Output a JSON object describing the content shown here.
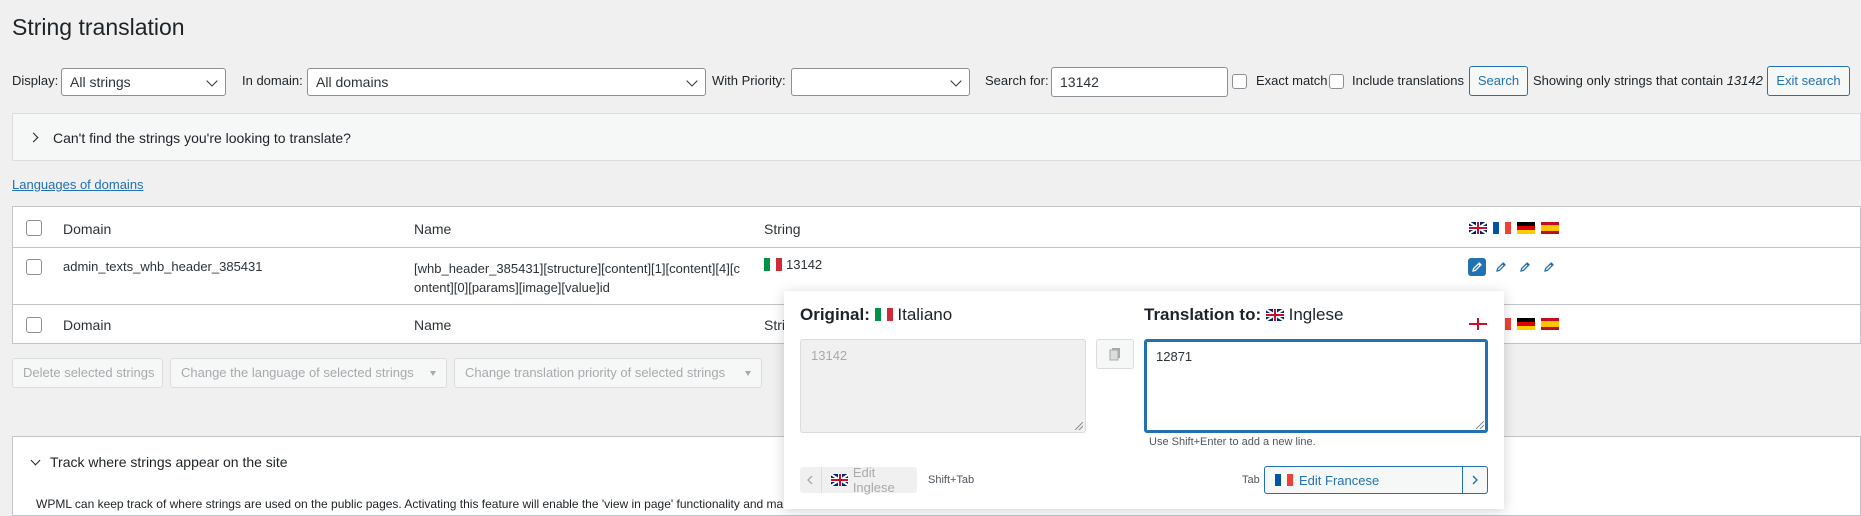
{
  "page": {
    "title": "String translation"
  },
  "filters": {
    "display_label": "Display:",
    "display_value": "All strings",
    "domain_label": "In domain:",
    "domain_value": "All domains",
    "priority_label": "With Priority:",
    "priority_value": "",
    "search_label": "Search for:",
    "search_value": "13142",
    "exact_match_label": "Exact match",
    "include_translations_label": "Include translations",
    "search_button": "Search",
    "showing_text": "Showing only strings that contain",
    "showing_term": "13142",
    "exit_search_button": "Exit search"
  },
  "help_box": {
    "text": "Can't find the strings you're looking to translate?"
  },
  "languages_link": "Languages of domains",
  "table": {
    "columns": {
      "domain": "Domain",
      "name": "Name",
      "string": "String"
    },
    "language_flags": [
      "gb-flag-icon",
      "fr-flag-icon",
      "de-flag-icon",
      "es-flag-icon"
    ],
    "rows": [
      {
        "domain": "admin_texts_whb_header_385431",
        "name_line1": "[whb_header_385431][structure][content][1][content][4][c",
        "name_line2": "ontent][0][params][image][value]id",
        "string": "13142"
      }
    ],
    "footer": {
      "domain": "Domain",
      "name": "Name",
      "string": "Stri"
    }
  },
  "bulk_actions": {
    "delete": "Delete selected strings",
    "change_language": "Change the language of selected strings",
    "change_priority": "Change translation priority of selected strings"
  },
  "track_box": {
    "title": "Track where strings appear on the site",
    "text": "WPML can keep track of where strings are used on the public pages. Activating this feature will enable the 'view in page' functionality and mal"
  },
  "popup": {
    "original_label": "Original:",
    "original_language": "Italiano",
    "original_text": "13142",
    "translation_label": "Translation to:",
    "translation_language": "Inglese",
    "translation_text": "12871",
    "hint": "Use Shift+Enter to add a new line.",
    "prev_button": "Edit Inglese",
    "prev_shortcut": "Shift+Tab",
    "next_shortcut": "Tab",
    "next_button": "Edit Francese"
  },
  "colors": {
    "accent": "#2271b1",
    "background": "#f0f0f1"
  }
}
